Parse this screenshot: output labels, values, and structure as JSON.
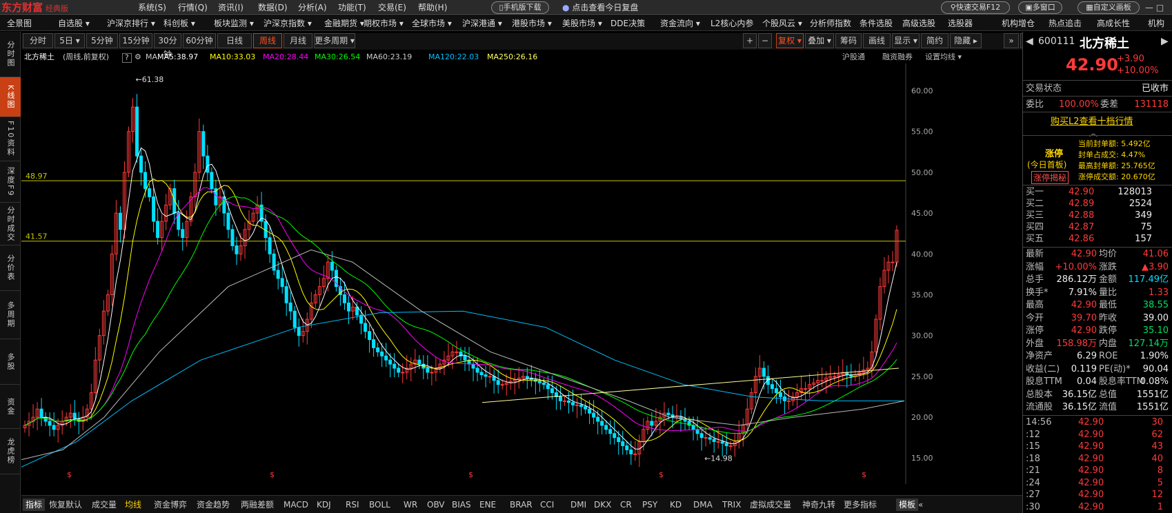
{
  "app": {
    "logo": "东方财富",
    "edition": "经典版"
  },
  "titlebar": {
    "menus": [
      "系统(S)",
      "行情(Q)",
      "资讯(I)",
      "数据(D)",
      "分析(A)",
      "功能(T)",
      "交易(E)",
      "帮助(H)"
    ],
    "mobile_btn": "手机版下载",
    "review_btn": "点击查看今日复盘",
    "quick_trade": "快速交易F12",
    "multi_window": "多窗口",
    "custom_layout": "自定义画板"
  },
  "navbar": [
    "全景图",
    "自选股 ▾",
    "沪深京排行 ▾",
    "科创板 ▾",
    "板块监测 ▾",
    "沪深京指数 ▾",
    "金融期货 ▾",
    "期权市场 ▾",
    "全球市场 ▾",
    "沪深港通 ▾",
    "港股市场 ▾",
    "美股市场 ▾",
    "DDE决策",
    "资金流向 ▾",
    "L2核心内参",
    "个股风云 ▾",
    "分析师指数",
    "条件选股",
    "高级选股",
    "选股器",
    "机构增仓",
    "热点追击",
    "高成长性",
    "机构"
  ],
  "leftbar": [
    "分时图",
    "K线图",
    "F10资料",
    "深度F9",
    "分时成交",
    "分价表",
    "多周期",
    "多股",
    "资金",
    "龙虎榜"
  ],
  "periods": [
    "分时",
    "5日 ▾",
    "5分钟",
    "15分钟",
    "30分钟",
    "60分钟",
    "日线",
    "周线",
    "月线",
    "更多周期 ▾"
  ],
  "toolbar_right": [
    "+",
    "−",
    "复权 ▾",
    "叠加 ▾",
    "筹码",
    "画线",
    "显示 ▾",
    "简约",
    "隐藏 ▸"
  ],
  "info": {
    "name": "北方稀土",
    "mode": "(周线,前复权)",
    "help": "?",
    "ma_label": "MA",
    "mas": [
      {
        "label": "MA5:38.97",
        "color": "#ffffff"
      },
      {
        "label": "MA10:33.03",
        "color": "#ffff00"
      },
      {
        "label": "MA20:28.44",
        "color": "#ff00ff"
      },
      {
        "label": "MA30:26.54",
        "color": "#00ff00"
      },
      {
        "label": "MA60:23.19",
        "color": "#cccccc"
      },
      {
        "label": "MA120:22.03",
        "color": "#00c0ff"
      },
      {
        "label": "MA250:26.16",
        "color": "#ffff66"
      }
    ],
    "right": [
      "沪股通",
      "融资融券",
      "设置均线 ▾"
    ]
  },
  "chart_data": {
    "type": "candlestick",
    "ylim": [
      13.5,
      63
    ],
    "yticks": [
      15,
      20,
      25,
      30,
      35,
      40,
      45,
      50,
      55,
      60
    ],
    "ytick_labels": [
      "15.00",
      "20.00",
      "25.00",
      "30.00",
      "35.00",
      "40.00",
      "45.00",
      "50.00",
      "55.00",
      "60.00"
    ],
    "hlines": [
      {
        "value": 48.97,
        "label": "48.97"
      },
      {
        "value": 41.57,
        "label": "41.57"
      }
    ],
    "annotations": [
      {
        "label": "61.38",
        "value": 61.38,
        "index": 26
      },
      {
        "label": "14.98",
        "value": 14.98,
        "index": 163
      }
    ],
    "close_path": [
      19,
      19.5,
      20,
      21,
      20,
      19.5,
      19,
      18.5,
      19,
      19.5,
      20,
      20.5,
      19.8,
      19.5,
      20,
      21,
      23,
      27,
      30,
      33,
      35,
      40,
      45,
      43,
      50,
      55,
      58,
      52,
      50,
      48,
      47,
      44,
      42,
      44,
      46,
      48,
      45,
      43,
      42,
      44,
      47,
      50,
      55,
      52,
      50,
      48,
      46,
      47,
      45,
      43,
      41,
      40,
      41,
      43,
      44,
      45,
      46,
      44,
      42,
      40,
      38,
      37,
      36,
      34,
      33,
      31,
      30,
      30.5,
      32,
      34,
      35,
      36,
      37,
      39,
      38,
      36,
      35,
      34,
      33,
      33.5,
      32.5,
      31.5,
      30.5,
      29.5,
      28.5,
      28,
      27.5,
      27,
      26.5,
      26,
      25.5,
      25.5,
      26,
      26.5,
      27,
      26.5,
      26,
      25.5,
      25.5,
      26,
      26.5,
      27,
      27.5,
      28,
      28,
      27.5,
      27,
      26.5,
      26,
      25.5,
      25.2,
      25,
      25,
      24.5,
      24,
      24,
      24.2,
      24.4,
      24.6,
      24.8,
      25,
      24.8,
      24.6,
      24.4,
      24.2,
      24,
      23.5,
      23,
      22.5,
      22,
      22,
      21.8,
      21.5,
      21.5,
      21.3,
      21,
      20.5,
      20,
      19.5,
      19,
      18.5,
      18,
      17.5,
      17,
      16.5,
      16,
      15.5,
      15.5,
      17,
      18.5,
      19.5,
      19,
      19.5,
      20,
      20.5,
      20.3,
      20,
      20,
      19.8,
      19.5,
      19,
      18.5,
      18,
      17.5,
      17.5,
      17.3,
      17,
      17,
      16.8,
      16.5,
      16.5,
      17,
      18,
      19,
      21,
      23,
      25,
      26,
      25,
      24,
      23.5,
      23,
      22.5,
      22,
      22,
      22.5,
      23,
      23.5,
      23.5,
      24,
      24.2,
      24.5,
      24.5,
      24.8,
      25,
      25,
      25.2,
      25.5,
      25.2,
      25,
      25.2,
      25.5,
      25.8,
      26,
      28,
      32,
      36,
      38,
      39,
      39,
      42.9
    ],
    "ma_lines": [
      {
        "name": "MA250",
        "color": "#00c0ff",
        "path": [
          [
            0,
            13.9
          ],
          [
            40,
            17
          ],
          [
            80,
            22
          ],
          [
            130,
            27
          ],
          [
            200,
            31
          ],
          [
            260,
            32.8
          ],
          [
            320,
            33
          ],
          [
            380,
            31
          ],
          [
            430,
            27
          ],
          [
            480,
            24
          ],
          [
            530,
            22.5
          ],
          [
            580,
            22
          ],
          [
            640,
            22
          ]
        ]
      },
      {
        "name": "MA120",
        "color": "#bbbbbb",
        "path": [
          [
            0,
            14.8
          ],
          [
            30,
            16
          ],
          [
            60,
            20
          ],
          [
            100,
            28
          ],
          [
            150,
            36
          ],
          [
            210,
            40.5
          ],
          [
            240,
            39
          ],
          [
            290,
            33
          ],
          [
            340,
            28
          ],
          [
            390,
            25
          ],
          [
            440,
            22
          ],
          [
            470,
            20
          ],
          [
            520,
            19
          ],
          [
            560,
            20
          ],
          [
            610,
            21
          ],
          [
            640,
            22
          ]
        ]
      }
    ]
  },
  "indicators": [
    "指标",
    "恢复默认",
    "成交量",
    "均线",
    "资金博弈",
    "资金趋势",
    "两融差额",
    "MACD",
    "KDJ",
    "RSI",
    "BOLL",
    "WR",
    "OBV",
    "BIAS",
    "ENE",
    "BRAR",
    "CCI",
    "DMI",
    "DKX",
    "CR",
    "PSY",
    "KD",
    "DMA",
    "TRIX",
    "虚拟成交量",
    "神奇九转",
    "更多指标",
    "模板"
  ],
  "quote": {
    "code": "600111",
    "name": "北方稀土",
    "price": "42.90",
    "change": "+3.90",
    "change_pct": "+10.00%",
    "trade_status_label": "交易状态",
    "trade_status": "已收市",
    "weibi_label": "委比",
    "weibi": "100.00%",
    "weicha_label": "委差",
    "weicha": "131118",
    "l2_link": "购买L2查看十档行情",
    "limit_title": "涨停",
    "limit_sub": "(今日首板)",
    "limit_btn": "涨停揭秘",
    "limit_stats": [
      "当前封单额: 5.492亿",
      "封单占成交: 4.47%",
      "最高封单额: 25.765亿",
      "涨停成交额: 20.670亿"
    ],
    "bids": [
      {
        "label": "买一",
        "price": "42.90",
        "vol": "128013"
      },
      {
        "label": "买二",
        "price": "42.89",
        "vol": "2524"
      },
      {
        "label": "买三",
        "price": "42.88",
        "vol": "349"
      },
      {
        "label": "买四",
        "price": "42.87",
        "vol": "75"
      },
      {
        "label": "买五",
        "price": "42.86",
        "vol": "157"
      }
    ],
    "stats": [
      [
        "最新",
        "42.90",
        "red",
        "均价",
        "41.06",
        "red"
      ],
      [
        "涨幅",
        "+10.00%",
        "red",
        "涨跌",
        "▲3.90",
        "red"
      ],
      [
        "总手",
        "286.12万",
        "wht",
        "金额",
        "117.49亿",
        "cyan"
      ],
      [
        "换手*",
        "7.91%",
        "wht",
        "量比",
        "1.33",
        "red"
      ],
      [
        "最高",
        "42.90",
        "red",
        "最低",
        "38.55",
        "grn"
      ],
      [
        "今开",
        "39.70",
        "red",
        "昨收",
        "39.00",
        "wht"
      ],
      [
        "涨停",
        "42.90",
        "red",
        "跌停",
        "35.10",
        "grn"
      ],
      [
        "外盘",
        "158.98万",
        "red",
        "内盘",
        "127.14万",
        "grn"
      ],
      [
        "净资产",
        "6.29",
        "wht",
        "ROE",
        "1.90%",
        "wht"
      ],
      [
        "收益(二)",
        "0.119",
        "wht",
        "PE(动)*",
        "90.04",
        "wht"
      ],
      [
        "股息TTM",
        "0.04",
        "wht",
        "股息率TTM",
        "0.08%",
        "wht"
      ],
      [
        "总股本",
        "36.15亿",
        "wht",
        "总值",
        "1551亿",
        "wht"
      ],
      [
        "流通股",
        "36.15亿",
        "wht",
        "流值",
        "1551亿",
        "wht"
      ]
    ],
    "ticks": [
      {
        "time": "14:56",
        "price": "42.90",
        "vol": "30"
      },
      {
        "time": ":12",
        "price": "42.90",
        "vol": "62"
      },
      {
        "time": ":15",
        "price": "42.90",
        "vol": "43"
      },
      {
        "time": ":18",
        "price": "42.90",
        "vol": "40"
      },
      {
        "time": ":21",
        "price": "42.90",
        "vol": "8"
      },
      {
        "time": ":24",
        "price": "42.90",
        "vol": "5"
      },
      {
        "time": ":27",
        "price": "42.90",
        "vol": "12"
      },
      {
        "time": ":30",
        "price": "42.90",
        "vol": "1"
      }
    ]
  },
  "colors": {
    "up": "#ff3a3a",
    "down": "#00e0ff",
    "accent": "#c84014"
  }
}
